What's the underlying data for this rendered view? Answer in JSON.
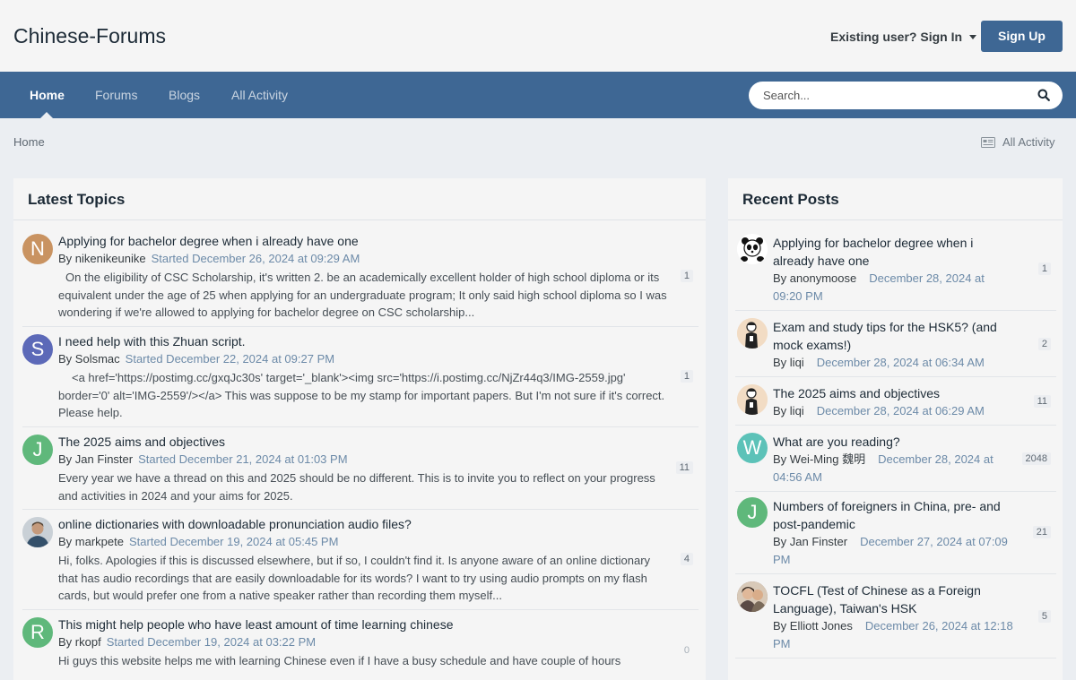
{
  "site": {
    "title": "Chinese-Forums",
    "signin_label": "Existing user? Sign In",
    "signup_label": "Sign Up"
  },
  "nav": {
    "tabs": [
      {
        "label": "Home",
        "active": true
      },
      {
        "label": "Forums",
        "active": false
      },
      {
        "label": "Blogs",
        "active": false
      },
      {
        "label": "All Activity",
        "active": false
      }
    ]
  },
  "search": {
    "placeholder": "Search..."
  },
  "breadcrumb": {
    "home": "Home",
    "all_activity": "All Activity"
  },
  "latest": {
    "title": "Latest Topics",
    "by_label": "By",
    "topics": [
      {
        "initial": "N",
        "color": "#c99361",
        "title": "Applying for bachelor degree when i already have one",
        "author": "nikenikeunike",
        "date": "Started December 26, 2024 at 09:29 AM",
        "snippet": "On the eligibility of CSC Scholarship, it's written 2. be an academically excellent holder of high school diploma or its equivalent under the age of 25 when applying for an undergraduate program; It only said high school diploma so I was wondering if we're allowed to applying for bachelor degree on CSC scholarship...",
        "count": "1"
      },
      {
        "initial": "S",
        "color": "#5c69b8",
        "title": "I need help with this Zhuan script.",
        "author": "Solsmac",
        "date": "Started December 22, 2024 at 09:27 PM",
        "snippet": "<a href='https://postimg.cc/gxqJc30s' target='_blank'><img src='https://i.postimg.cc/NjZr44q3/IMG-2559.jpg' border='0' alt='IMG-2559'/></a>    This was suppose to be my stamp for important papers. But I'm not sure if it's correct. Please help.",
        "count": "1"
      },
      {
        "initial": "J",
        "color": "#5fb87b",
        "title": "The 2025 aims and objectives",
        "author": "Jan Finster",
        "date": "Started December 21, 2024 at 01:03 PM",
        "snippet": "Every year we have a thread on this and 2025 should be no different.    This is to invite you to reflect on your progress and activities in 2024 and your aims for 2025.",
        "count": "11"
      },
      {
        "initial": "",
        "color": "#4a5a6a",
        "title": "online dictionaries with downloadable pronunciation audio files?",
        "author": "markpete",
        "date": "Started December 19, 2024 at 05:45 PM",
        "snippet": "Hi, folks. Apologies if this is discussed elsewhere, but if so, I couldn't find it.   Is anyone aware of an online dictionary that has audio recordings that are easily downloadable for its words? I want to try using audio prompts on my flash cards, but would prefer one from a native speaker rather than recording them myself...",
        "count": "4"
      },
      {
        "initial": "R",
        "color": "#5fb87b",
        "title": "This might help people who have least amount of time learning chinese",
        "author": "rkopf",
        "date": "Started December 19, 2024 at 03:22 PM",
        "snippet": "Hi guys this website helps me with learning Chinese even if I have a busy schedule and have couple of hours",
        "count": "0"
      }
    ]
  },
  "recent": {
    "title": "Recent Posts",
    "by_label": "By",
    "posts": [
      {
        "avatar": "panda",
        "initial": "",
        "color": "#ffffff",
        "title": "Applying for bachelor degree when i already have one",
        "author": "anonymoose",
        "date": "December 28, 2024 at 09:20 PM",
        "count": "1"
      },
      {
        "avatar": "person",
        "initial": "",
        "color": "#f2dcc4",
        "title": "Exam and study tips for the HSK5? (and mock exams!)",
        "author": "liqi",
        "date": "December 28, 2024 at 06:34 AM",
        "count": "2"
      },
      {
        "avatar": "person",
        "initial": "",
        "color": "#f2dcc4",
        "title": "The 2025 aims and objectives",
        "author": "liqi",
        "date": "December 28, 2024 at 06:29 AM",
        "count": "11"
      },
      {
        "avatar": "letter",
        "initial": "W",
        "color": "#5cc2b8",
        "title": "What are you reading?",
        "author": "Wei-Ming 魏明",
        "date": "December 28, 2024 at 04:56 AM",
        "count": "2048"
      },
      {
        "avatar": "letter",
        "initial": "J",
        "color": "#5fb87b",
        "title": "Numbers of foreigners in China, pre- and post-pandemic",
        "author": "Jan Finster",
        "date": "December 27, 2024 at 07:09 PM",
        "count": "21"
      },
      {
        "avatar": "photo",
        "initial": "",
        "color": "#8a6e58",
        "title": "TOCFL (Test of Chinese as a Foreign Language), Taiwan's HSK",
        "author": "Elliott Jones",
        "date": "December 26, 2024 at 12:18 PM",
        "count": "5"
      }
    ]
  }
}
